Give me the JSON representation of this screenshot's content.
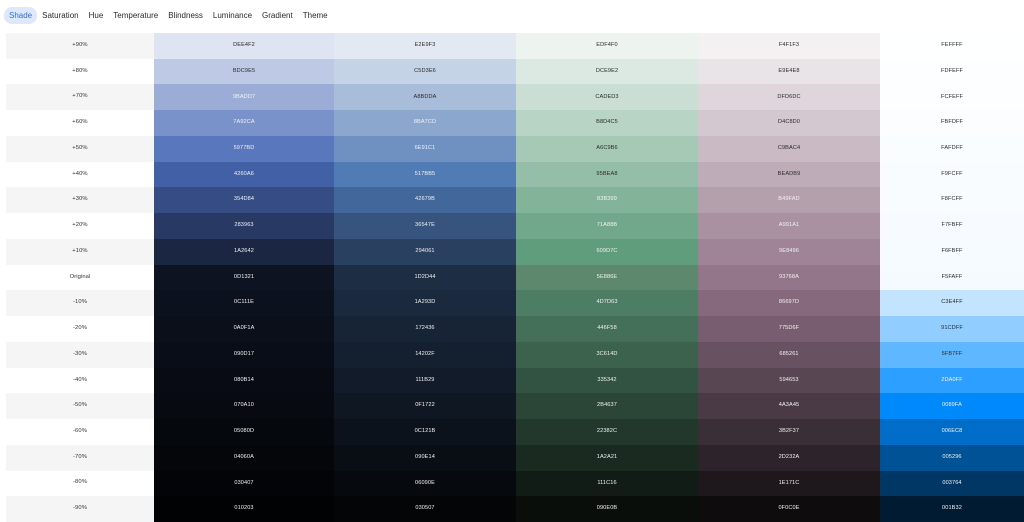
{
  "tabs": [
    {
      "label": "Shade",
      "active": true
    },
    {
      "label": "Saturation",
      "active": false
    },
    {
      "label": "Hue",
      "active": false
    },
    {
      "label": "Temperature",
      "active": false
    },
    {
      "label": "Blindness",
      "active": false
    },
    {
      "label": "Luminance",
      "active": false
    },
    {
      "label": "Gradient",
      "active": false
    },
    {
      "label": "Theme",
      "active": false
    }
  ],
  "rows": [
    {
      "label": "+90%",
      "colors": [
        "DEE4F2",
        "E2E9F3",
        "EDF4F0",
        "F4F1F3",
        "FEFFFF"
      ]
    },
    {
      "label": "+80%",
      "colors": [
        "BDC9E5",
        "C5D3E6",
        "DCE9E2",
        "E9E4E8",
        "FDFEFF"
      ]
    },
    {
      "label": "+70%",
      "colors": [
        "9BADD7",
        "A8BDDA",
        "CADED3",
        "DFD6DC",
        "FCFEFF"
      ]
    },
    {
      "label": "+60%",
      "colors": [
        "7A92CA",
        "8BA7CD",
        "B8D4C5",
        "D4C8D0",
        "FBFDFF"
      ]
    },
    {
      "label": "+50%",
      "colors": [
        "5977BD",
        "6E91C1",
        "A6C9B6",
        "C9BAC4",
        "FAFDFF"
      ]
    },
    {
      "label": "+40%",
      "colors": [
        "4260A6",
        "517BB5",
        "95BEA8",
        "BEADB9",
        "F9FCFF"
      ]
    },
    {
      "label": "+30%",
      "colors": [
        "354D84",
        "42679B",
        "83B399",
        "B49FAD",
        "F8FCFF"
      ]
    },
    {
      "label": "+20%",
      "colors": [
        "283963",
        "36547E",
        "71A88B",
        "A991A1",
        "F7FBFF"
      ]
    },
    {
      "label": "+10%",
      "colors": [
        "1A2642",
        "294061",
        "609D7C",
        "9E8496",
        "F6FBFF"
      ]
    },
    {
      "label": "Original",
      "colors": [
        "0D1321",
        "1D2D44",
        "5E886E",
        "93768A",
        "F5FAFF"
      ]
    },
    {
      "label": "-10%",
      "colors": [
        "0C111E",
        "1A293D",
        "4D7D63",
        "86697D",
        "C3E4FF"
      ]
    },
    {
      "label": "-20%",
      "colors": [
        "0A0F1A",
        "172436",
        "446F58",
        "775D6F",
        "91CDFF"
      ]
    },
    {
      "label": "-30%",
      "colors": [
        "090D17",
        "14202F",
        "3C614D",
        "685261",
        "5FB7FF"
      ]
    },
    {
      "label": "-40%",
      "colors": [
        "080B14",
        "111B29",
        "335342",
        "594653",
        "2DA0FF"
      ]
    },
    {
      "label": "-50%",
      "colors": [
        "070A10",
        "0F1722",
        "2B4637",
        "4A3A45",
        "0089FA"
      ]
    },
    {
      "label": "-60%",
      "colors": [
        "05080D",
        "0C121B",
        "22382C",
        "3B2F37",
        "006EC8"
      ]
    },
    {
      "label": "-70%",
      "colors": [
        "04060A",
        "090E14",
        "1A2A21",
        "2D232A",
        "005296"
      ]
    },
    {
      "label": "-80%",
      "colors": [
        "030407",
        "06090E",
        "111C16",
        "1E171C",
        "003764"
      ]
    },
    {
      "label": "-90%",
      "colors": [
        "010203",
        "030507",
        "090E0B",
        "0F0C0E",
        "001B32"
      ]
    }
  ]
}
